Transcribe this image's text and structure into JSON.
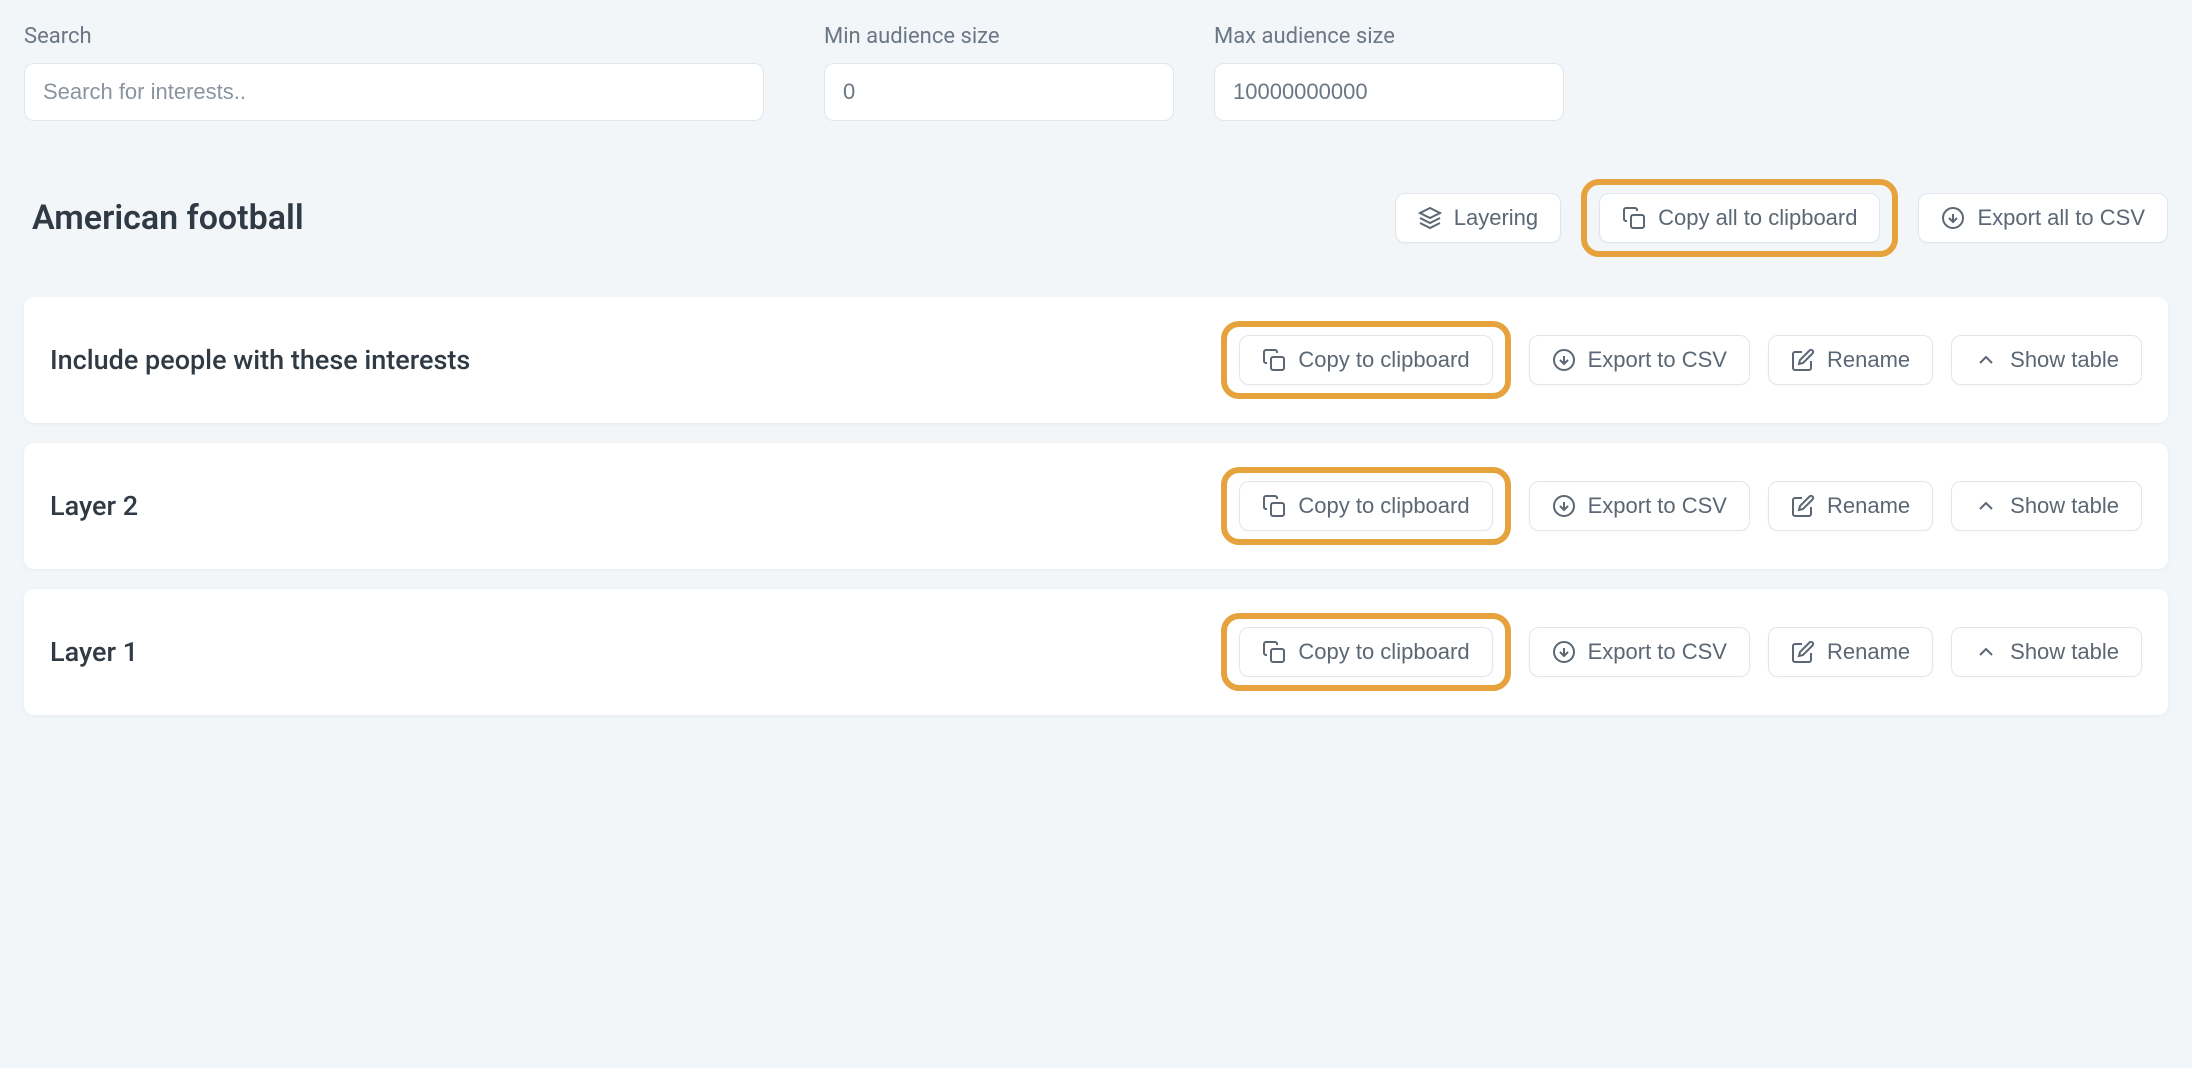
{
  "filters": {
    "search": {
      "label": "Search",
      "placeholder": "Search for interests.."
    },
    "min": {
      "label": "Min audience size",
      "value": "0"
    },
    "max": {
      "label": "Max audience size",
      "value": "10000000000"
    }
  },
  "page": {
    "title": "American football",
    "actions": {
      "layering": "Layering",
      "copy_all": "Copy all to clipboard",
      "export_all": "Export all to CSV"
    }
  },
  "row_actions": {
    "copy": "Copy to clipboard",
    "export": "Export to CSV",
    "rename": "Rename",
    "show": "Show table"
  },
  "layers": [
    {
      "title": "Include people with these interests"
    },
    {
      "title": "Layer 2"
    },
    {
      "title": "Layer 1"
    }
  ]
}
